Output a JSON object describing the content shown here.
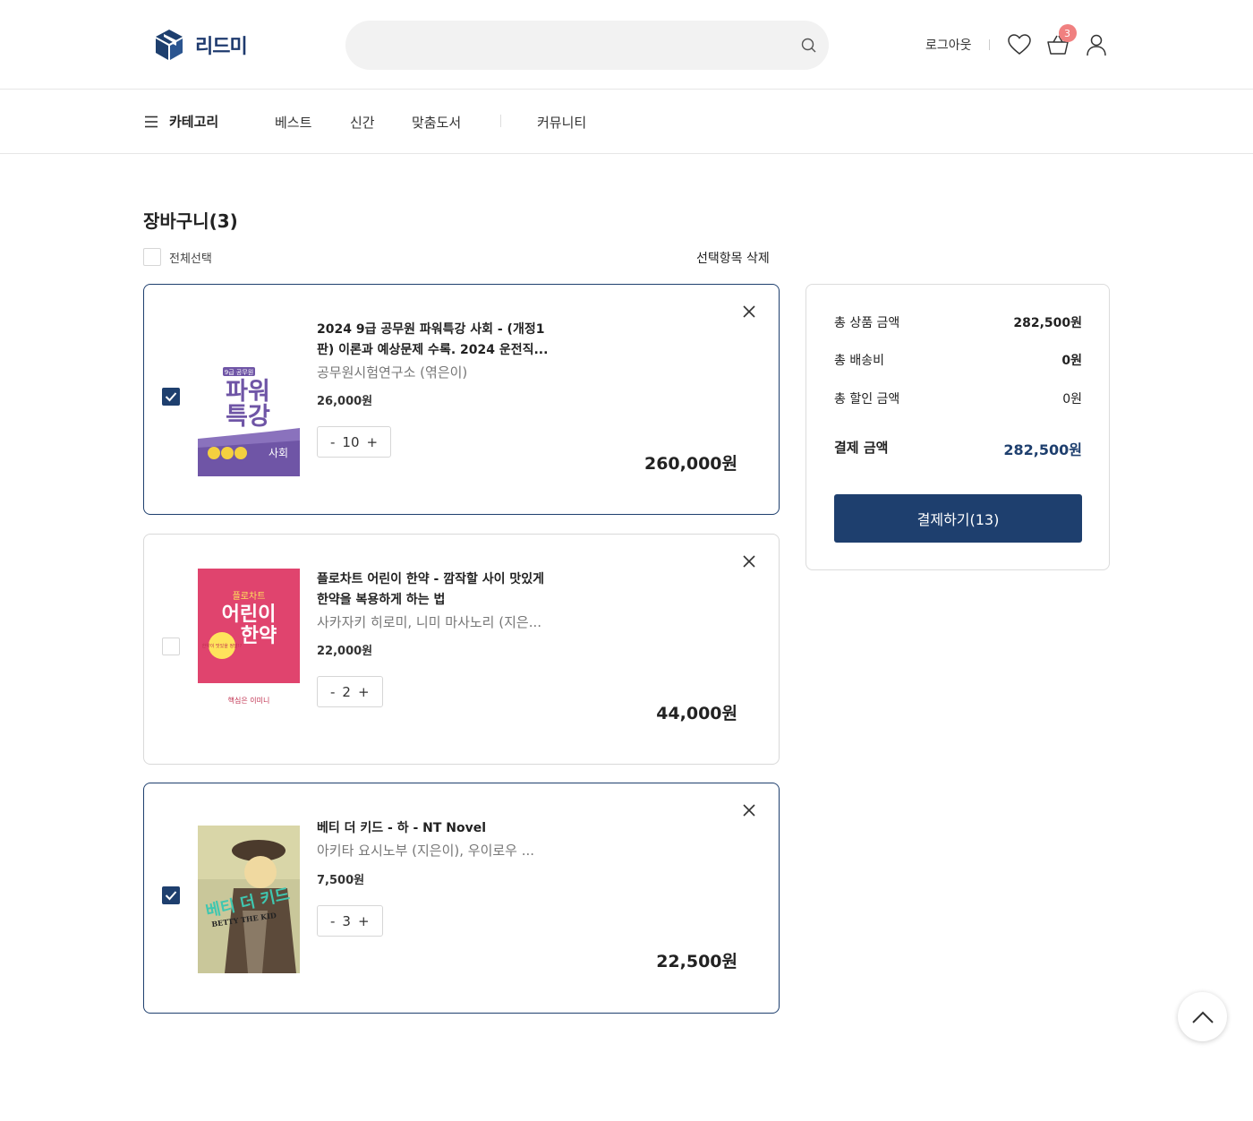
{
  "header": {
    "logo_text": "리드미",
    "search_placeholder": "",
    "logout_label": "로그아웃",
    "cart_count": "3"
  },
  "nav": {
    "category_label": "카테고리",
    "links": [
      "베스트",
      "신간",
      "맞춤도서",
      "커뮤니티"
    ]
  },
  "cart": {
    "title": "장바구니(3)",
    "select_all_label": "전체선택",
    "delete_selected_label": "선택항목 삭제",
    "items": [
      {
        "checked": true,
        "title": "2024 9급 공무원 파워특강 사회 - (개정1판) 이론과 예상문제 수록. 2024 운전직...",
        "author": "공무원시험연구소 (엮은이)",
        "unit_price": "26,000원",
        "qty": "10",
        "total": "260,000원",
        "cover_texts": {
          "badge": "9급 공무원",
          "line1": "파워",
          "line2": "특강",
          "subject": "사회"
        }
      },
      {
        "checked": false,
        "title": "플로차트 어린이 한약 - 깜작할 사이 맛있게 한약을 복용하게 하는 법",
        "author": "사카자키 히로미, 니미 마사노리 (지은...",
        "unit_price": "22,000원",
        "qty": "2",
        "total": "44,000원",
        "cover_texts": {
          "top": "플로차트",
          "line1": "어린이",
          "line2": "한약",
          "circle": "한약이 맛있을 정말!?",
          "bottom": "핵심은 이미니"
        }
      },
      {
        "checked": true,
        "title": "베티 더 키드 - 하 - NT Novel",
        "author": "아키타 요시노부 (지은이), 우이로우 ...",
        "unit_price": "7,500원",
        "qty": "3",
        "total": "22,500원",
        "cover_texts": {
          "title": "베티 더 키드",
          "en": "BETTY THE KID"
        }
      }
    ]
  },
  "summary": {
    "rows": [
      {
        "label": "총 상품 금액",
        "value": "282,500원"
      },
      {
        "label": "총 배송비",
        "value": "0원"
      },
      {
        "label": "총 할인 금액",
        "value": "0원"
      }
    ],
    "final_label": "결제 금액",
    "final_value": "282,500원",
    "pay_button": "결제하기(13)"
  },
  "colors": {
    "primary": "#1e3f6e",
    "badge": "#f08080",
    "border": "#d9d9d9"
  }
}
